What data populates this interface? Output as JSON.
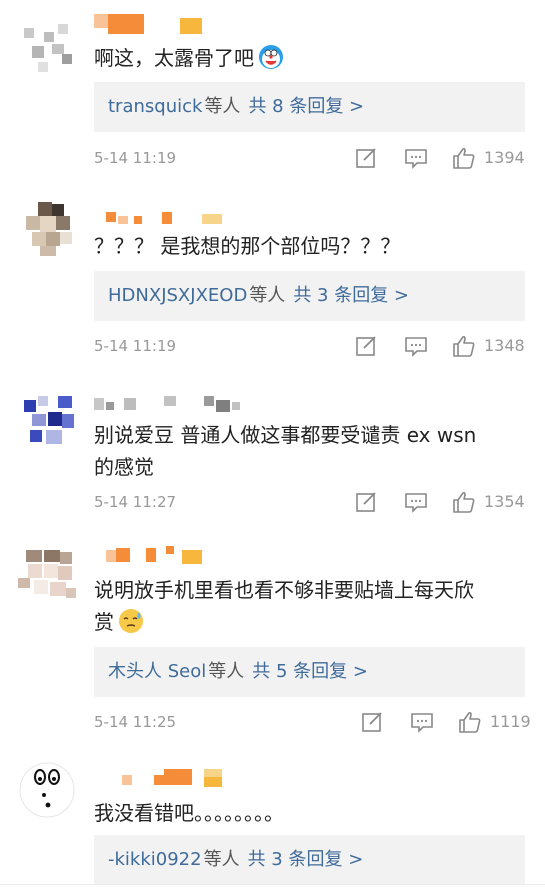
{
  "comments": [
    {
      "text": "啊这，太露骨了吧",
      "emoji": "doraemon-emoji",
      "reply_user": "transquick",
      "reply_join": "等人",
      "reply_count": "共 8 条回复 >",
      "time": "5-14 11:19",
      "likes": "1394"
    },
    {
      "text": "？？？ 是我想的那个部位吗？？？",
      "reply_user": "HDNXJSXJXEOD",
      "reply_join": "等人",
      "reply_count": "共 3 条回复 >",
      "time": "5-14 11:19",
      "likes": "1348"
    },
    {
      "text_line1": "别说爱豆  普通人做这事都要受谴责  ex wsn",
      "text_line2": "的感觉",
      "time": "5-14 11:27",
      "likes": "1354"
    },
    {
      "text_line1": "说明放手机里看也看不够非要贴墙上每天欣",
      "text_line2": "赏",
      "emoji": "sweat-emoji",
      "reply_user": "木头人 Seol",
      "reply_join": "等人",
      "reply_count": "共 5 条回复 >",
      "time": "5-14 11:25",
      "likes": "1119"
    },
    {
      "text": "我没看错吧。。。。。。。。",
      "reply_user": "-kikki0922",
      "reply_join": "等人",
      "reply_count": "共 3 条回复 >"
    }
  ],
  "icons": {
    "comment_edit": "edit-icon",
    "comment_reply": "reply-icon",
    "like": "thumbs-up-icon"
  },
  "colors": {
    "link": "#3f6b9b",
    "meta": "#999999",
    "reply_bg": "#f2f2f2",
    "name_orange": "#f58c3a",
    "name_yellow": "#f6b73c"
  }
}
